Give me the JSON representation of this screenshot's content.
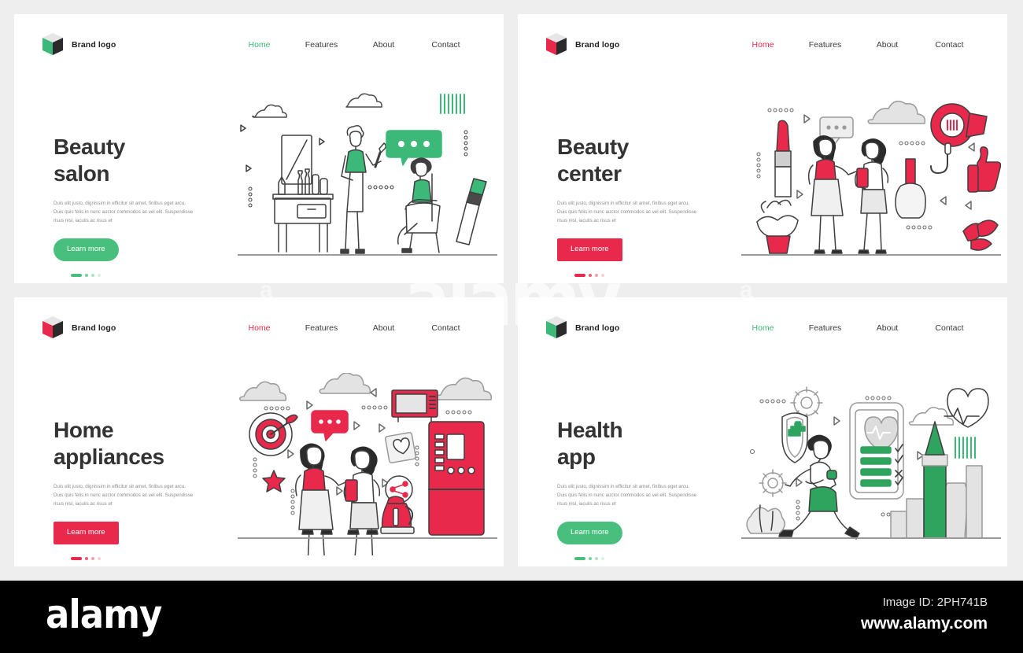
{
  "theme": {
    "green": "#49bf7d",
    "green_text": "#3cb878",
    "red": "#e8294b",
    "heading_color": "#333333",
    "body_color": "#8d8d8d",
    "page_bg": "#eeeeee",
    "panel_bg": "#ffffff",
    "footer_bg": "#000000"
  },
  "watermark": {
    "center_text": "alamy",
    "side_left": "a",
    "side_right": "a"
  },
  "footer": {
    "logo": "alamy",
    "image_id": "Image ID: 2PH741B",
    "site": "www.alamy.com"
  },
  "common": {
    "brand_name": "Brand logo",
    "body_text": "Duis elit justo, dignissim in efficitur sit amet, finibus eget arcu. Duis quis felis in nunc auctor commodos ac vel elit. Suspendisse risus nisl, iaculis ac risus et",
    "cta_label": "Learn more",
    "nav": [
      "Home",
      "Features",
      "About",
      "Contact"
    ]
  },
  "panels": [
    {
      "id": "beauty-salon",
      "accent": "green",
      "logo_face": "#3cb878",
      "nav_active": "Home",
      "nav": [
        "Home",
        "Features",
        "About",
        "Contact"
      ],
      "brand_name": "Brand logo",
      "title_line1": "Beauty",
      "title_line2": "salon",
      "body_text": "Duis elit justo, dignissim in efficitur sit amet, finibus eget arcu. Duis quis felis in nunc auctor commodos ac vel elit. Suspendisse risus nisl, iaculis ac risus et",
      "cta_label": "Learn more",
      "cta_shape": "rounded",
      "illustration": "beauty-salon-scene"
    },
    {
      "id": "beauty-center",
      "accent": "red",
      "logo_face": "#e8294b",
      "nav_active": "Home",
      "nav": [
        "Home",
        "Features",
        "About",
        "Contact"
      ],
      "brand_name": "Brand logo",
      "title_line1": "Beauty",
      "title_line2": "center",
      "body_text": "Duis elit justo, dignissim in efficitur sit amet, finibus eget arcu. Duis quis felis in nunc auctor commodos ac vel elit. Suspendisse risus nisl, iaculis ac risus et",
      "cta_label": "Learn more",
      "cta_shape": "square",
      "illustration": "beauty-center-scene"
    },
    {
      "id": "home-appliances",
      "accent": "red",
      "logo_face": "#e8294b",
      "nav_active": "Home",
      "nav": [
        "Home",
        "Features",
        "About",
        "Contact"
      ],
      "brand_name": "Brand logo",
      "title_line1": "Home",
      "title_line2": "appliances",
      "body_text": "Duis elit justo, dignissim in efficitur sit amet, finibus eget arcu. Duis quis felis in nunc auctor commodos ac vel elit. Suspendisse risus nisl, iaculis ac risus et",
      "cta_label": "Learn more",
      "cta_shape": "square",
      "illustration": "home-appliances-scene"
    },
    {
      "id": "health-app",
      "accent": "green",
      "logo_face": "#3cb878",
      "nav_active": "Home",
      "nav": [
        "Home",
        "Features",
        "About",
        "Contact"
      ],
      "brand_name": "Brand logo",
      "title_line1": "Health",
      "title_line2": "app",
      "body_text": "Duis elit justo, dignissim in efficitur sit amet, finibus eget arcu. Duis quis felis in nunc auctor commodos ac vel elit. Suspendisse risus nisl, iaculis ac risus et",
      "cta_label": "Learn more",
      "cta_shape": "rounded",
      "illustration": "health-app-scene"
    }
  ]
}
